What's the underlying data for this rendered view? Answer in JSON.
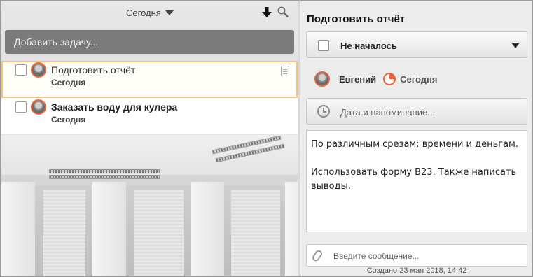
{
  "left": {
    "date_filter": "Сегодня",
    "add_task_placeholder": "Добавить задачу...",
    "tasks": [
      {
        "title": "Подготовить отчёт",
        "due": "Сегодня",
        "selected": true
      },
      {
        "title": "Заказать воду для кулера",
        "due": "Сегодня",
        "selected": false
      }
    ],
    "icons": {
      "sort": "sort-down-icon",
      "search": "search-icon",
      "note": "note-icon"
    }
  },
  "detail": {
    "title": "Подготовить отчёт",
    "status": "Не началось",
    "assignee": "Евгений",
    "due": "Сегодня",
    "reminder_placeholder": "Дата и напоминание...",
    "notes": "По различным срезам: времени и деньгам.\n\nИспользовать форму B23. Также написать выводы.",
    "message_placeholder": "Введите сообщение...",
    "created": "Создано 23 мая 2018, 14:42"
  },
  "colors": {
    "accent": "#e8643a",
    "selection_border": "#f4c27a",
    "add_task_bg": "#7a7a7a"
  }
}
